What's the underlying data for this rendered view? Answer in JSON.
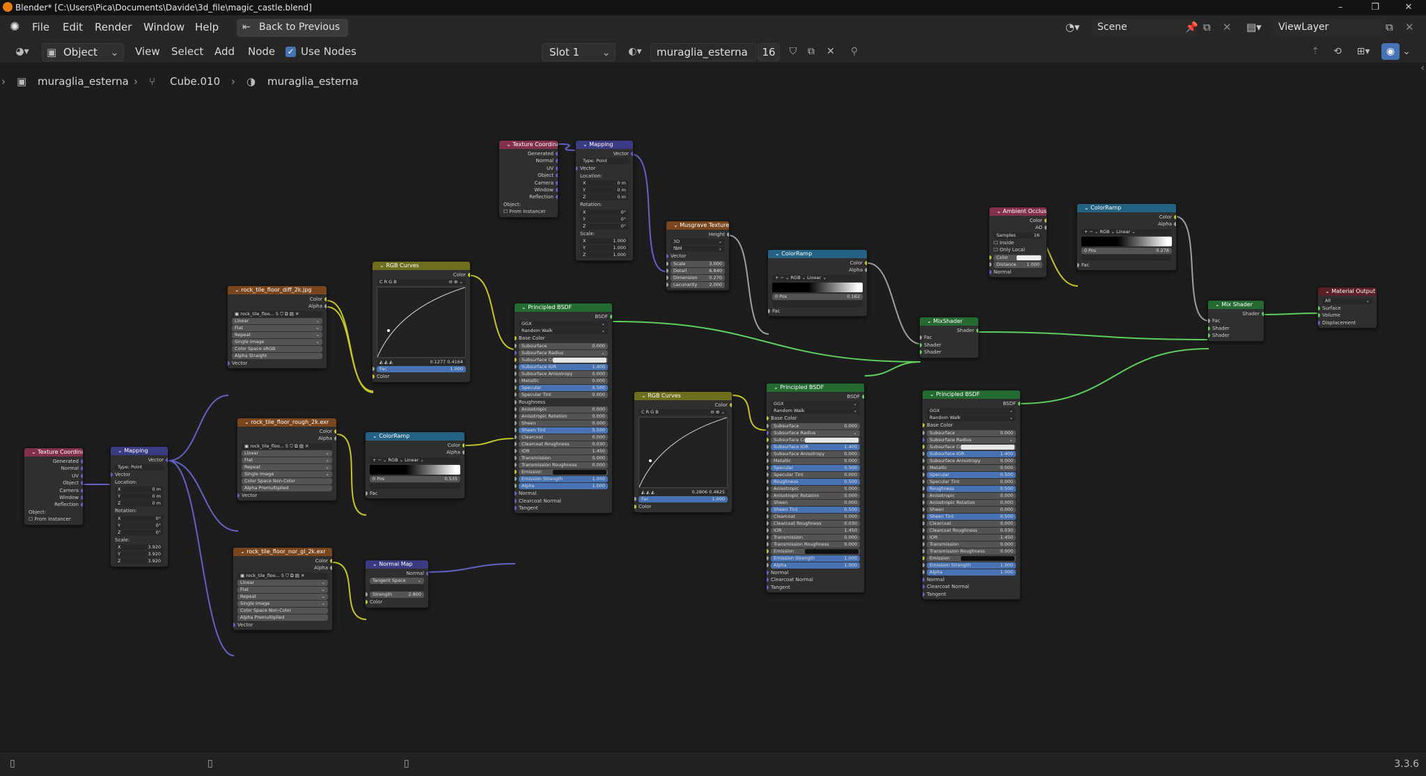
{
  "window": {
    "title": "Blender* [C:\\Users\\Pica\\Documents\\Davide\\3d_file\\magic_castle.blend]",
    "minimize": "–",
    "restore": "❐",
    "close": "✕"
  },
  "menu": {
    "items": [
      "File",
      "Edit",
      "Render",
      "Window",
      "Help"
    ],
    "back_button": "Back to Previous",
    "scene_label": "Scene",
    "viewlayer_label": "ViewLayer"
  },
  "editor_header": {
    "mode": "Object",
    "menus": [
      "View",
      "Select",
      "Add",
      "Node"
    ],
    "use_nodes_label": "Use Nodes",
    "use_nodes_checked": true,
    "slot": "Slot 1",
    "material_name": "muraglia_esterna",
    "user_count": "16"
  },
  "breadcrumb": [
    "muraglia_esterna",
    "Cube.010",
    "muraglia_esterna"
  ],
  "nodes": {
    "texcoord1": {
      "title": "Texture Coordinate",
      "outputs": [
        "Generated",
        "Normal",
        "UV",
        "Object",
        "Camera",
        "Window",
        "Reflection"
      ],
      "object_label": "Object:",
      "from_instancer": "From Instancer"
    },
    "mapping1": {
      "title": "Mapping",
      "out": "Vector",
      "type_label": "Type:",
      "type_value": "Point",
      "in": "Vector",
      "location": "Location:",
      "rotation": "Rotation:",
      "scale": "Scale:",
      "loc": [
        [
          "X",
          "0 m"
        ],
        [
          "Y",
          "0 m"
        ],
        [
          "Z",
          "0 m"
        ]
      ],
      "rot": [
        [
          "X",
          "0°"
        ],
        [
          "Y",
          "0°"
        ],
        [
          "Z",
          "0°"
        ]
      ],
      "scl": [
        [
          "X",
          "3.920"
        ],
        [
          "Y",
          "3.920"
        ],
        [
          "Z",
          "3.920"
        ]
      ]
    },
    "img_diff": {
      "title": "rock_tile_floor_diff_2k.jpg",
      "outputs": [
        "Color",
        "Alpha"
      ],
      "file": "rock_tile_floo...",
      "users": "5",
      "opts": [
        "Linear",
        "Flat",
        "Repeat",
        "Single Image"
      ],
      "cs_label": "Color Space",
      "cs_value": "sRGB",
      "alpha_label": "Alpha",
      "alpha_value": "Straight",
      "in": "Vector"
    },
    "img_rough": {
      "title": "rock_tile_floor_rough_2k.exr",
      "outputs": [
        "Color",
        "Alpha"
      ],
      "file": "rock_tile_floo...",
      "users": "5",
      "opts": [
        "Linear",
        "Flat",
        "Repeat",
        "Single Image"
      ],
      "cs_label": "Color Space",
      "cs_value": "Non-Color",
      "alpha_label": "Alpha",
      "alpha_value": "Premultiplied",
      "in": "Vector"
    },
    "img_nor": {
      "title": "rock_tile_floor_nor_gl_2k.exr",
      "outputs": [
        "Color",
        "Alpha"
      ],
      "file": "rock_tile_floo...",
      "users": "5",
      "opts": [
        "Linear",
        "Flat",
        "Repeat",
        "Single Image"
      ],
      "cs_label": "Color Space",
      "cs_value": "Non-Color",
      "alpha_label": "Alpha",
      "alpha_value": "Premultiplied",
      "in": "Vector"
    },
    "curves1": {
      "title": "RGB Curves",
      "out": "Color",
      "chans": [
        "C",
        "R",
        "G",
        "B"
      ],
      "px": "0.1277",
      "py": "0.4164",
      "fac_label": "Fac",
      "fac": "1.000",
      "in": "Color"
    },
    "ramp1": {
      "title": "ColorRamp",
      "outputs": [
        "Color",
        "Alpha"
      ],
      "mode": "RGB",
      "interp": "Linear",
      "idx": "0",
      "pos_label": "Pos",
      "pos": "0.535",
      "in": "Fac"
    },
    "normalmap": {
      "title": "Normal Map",
      "out": "Normal",
      "space": "Tangent Space",
      "strength_label": "Strength",
      "strength": "2.800",
      "in": "Color"
    },
    "texcoord2": {
      "title": "Texture Coordinate",
      "outputs": [
        "Generated",
        "Normal",
        "UV",
        "Object",
        "Camera",
        "Window",
        "Reflection"
      ],
      "object_label": "Object:",
      "from_instancer": "From Instancer"
    },
    "mapping2": {
      "title": "Mapping",
      "out": "Vector",
      "type_label": "Type:",
      "type_value": "Point",
      "in": "Vector",
      "location": "Location:",
      "rotation": "Rotation:",
      "scale": "Scale:",
      "loc": [
        [
          "X",
          "0 m"
        ],
        [
          "Y",
          "0 m"
        ],
        [
          "Z",
          "0 m"
        ]
      ],
      "rot": [
        [
          "X",
          "0°"
        ],
        [
          "Y",
          "0°"
        ],
        [
          "Z",
          "0°"
        ]
      ],
      "scl": [
        [
          "X",
          "1.000"
        ],
        [
          "Y",
          "1.000"
        ],
        [
          "Z",
          "1.000"
        ]
      ]
    },
    "musgrave": {
      "title": "Musgrave Texture",
      "out": "Height",
      "dim": "3D",
      "kind": "fBM",
      "in": "Vector",
      "fields": [
        [
          "Scale",
          "3.000"
        ],
        [
          "Detail",
          "6.840"
        ],
        [
          "Dimension",
          "0.270"
        ],
        [
          "Lacunarity",
          "2.000"
        ]
      ]
    },
    "bsdf1": {
      "title": "Principled BSDF",
      "out": "BSDF",
      "dist": "GGX",
      "sss": "Random Walk",
      "rows": [
        [
          "Base Color",
          ""
        ],
        [
          "Subsurface",
          "0.000"
        ],
        [
          "Subsurface Radius",
          ""
        ],
        [
          "Subsurface Colo",
          ""
        ],
        [
          "Subsurface IOR",
          "1.400"
        ],
        [
          "Subsurface Anisotropy",
          "0.000"
        ],
        [
          "Metallic",
          "0.000"
        ],
        [
          "Specular",
          "0.500"
        ],
        [
          "Specular Tint",
          "0.000"
        ],
        [
          "Roughness",
          ""
        ],
        [
          "Anisotropic",
          "0.000"
        ],
        [
          "Anisotropic Rotation",
          "0.000"
        ],
        [
          "Sheen",
          "0.000"
        ],
        [
          "Sheen Tint",
          "0.500"
        ],
        [
          "Clearcoat",
          "0.000"
        ],
        [
          "Clearcoat Roughness",
          "0.030"
        ],
        [
          "IOR",
          "1.450"
        ],
        [
          "Transmission",
          "0.000"
        ],
        [
          "Transmission Roughness",
          "0.000"
        ],
        [
          "Emission",
          ""
        ],
        [
          "Emission Strength",
          "1.000"
        ],
        [
          "Alpha",
          "1.000"
        ],
        [
          "Normal",
          ""
        ],
        [
          "Clearcoat Normal",
          ""
        ],
        [
          "Tangent",
          ""
        ]
      ]
    },
    "curves2": {
      "title": "RGB Curves",
      "out": "Color",
      "chans": [
        "C",
        "R",
        "G",
        "B"
      ],
      "px": "0.2806",
      "py": "0.4825",
      "fac_label": "Fac",
      "fac": "1.000",
      "in": "Color"
    },
    "ramp2": {
      "title": "ColorRamp",
      "outputs": [
        "Color",
        "Alpha"
      ],
      "mode": "RGB",
      "interp": "Linear",
      "idx": "0",
      "pos_label": "Pos",
      "pos": "0.162",
      "in": "Fac"
    },
    "bsdf2": {
      "title": "Principled BSDF",
      "out": "BSDF",
      "dist": "GGX",
      "sss": "Random Walk",
      "rows": [
        [
          "Base Color",
          ""
        ],
        [
          "Subsurface",
          "0.000"
        ],
        [
          "Subsurface Radius",
          ""
        ],
        [
          "Subsurface Colo",
          ""
        ],
        [
          "Subsurface IOR",
          "1.400"
        ],
        [
          "Subsurface Anisotropy",
          "0.000"
        ],
        [
          "Metallic",
          "0.000"
        ],
        [
          "Specular",
          "0.500"
        ],
        [
          "Specular Tint",
          "0.000"
        ],
        [
          "Roughness",
          "0.500"
        ],
        [
          "Anisotropic",
          "0.000"
        ],
        [
          "Anisotropic Rotation",
          "0.000"
        ],
        [
          "Sheen",
          "0.000"
        ],
        [
          "Sheen Tint",
          "0.500"
        ],
        [
          "Clearcoat",
          "0.000"
        ],
        [
          "Clearcoat Roughness",
          "0.030"
        ],
        [
          "IOR",
          "1.450"
        ],
        [
          "Transmission",
          "0.000"
        ],
        [
          "Transmission Roughness",
          "0.000"
        ],
        [
          "Emission",
          ""
        ],
        [
          "Emission Strength",
          "1.000"
        ],
        [
          "Alpha",
          "1.000"
        ],
        [
          "Normal",
          ""
        ],
        [
          "Clearcoat Normal",
          ""
        ],
        [
          "Tangent",
          ""
        ]
      ]
    },
    "mix1": {
      "title": "MixShader",
      "out": "Shader",
      "inputs": [
        "Fac",
        "Shader",
        "Shader"
      ]
    },
    "bsdf3": {
      "title": "Principled BSDF",
      "out": "BSDF",
      "dist": "GGX",
      "sss": "Random Walk",
      "rows": [
        [
          "Base Color",
          ""
        ],
        [
          "Subsurface",
          "0.000"
        ],
        [
          "Subsurface Radius",
          ""
        ],
        [
          "Subsurface Colo",
          ""
        ],
        [
          "Subsurface IOR",
          "1.400"
        ],
        [
          "Subsurface Anisotropy",
          "0.000"
        ],
        [
          "Metallic",
          "0.000"
        ],
        [
          "Specular",
          "0.500"
        ],
        [
          "Specular Tint",
          "0.000"
        ],
        [
          "Roughness",
          "0.500"
        ],
        [
          "Anisotropic",
          "0.000"
        ],
        [
          "Anisotropic Rotation",
          "0.000"
        ],
        [
          "Sheen",
          "0.000"
        ],
        [
          "Sheen Tint",
          "0.500"
        ],
        [
          "Clearcoat",
          "0.000"
        ],
        [
          "Clearcoat Roughness",
          "0.030"
        ],
        [
          "IOR",
          "1.450"
        ],
        [
          "Transmission",
          "0.000"
        ],
        [
          "Transmission Roughness",
          "0.000"
        ],
        [
          "Emission",
          ""
        ],
        [
          "Emission Strength",
          "1.000"
        ],
        [
          "Alpha",
          "1.000"
        ],
        [
          "Normal",
          ""
        ],
        [
          "Clearcoat Normal",
          ""
        ],
        [
          "Tangent",
          ""
        ]
      ]
    },
    "ao": {
      "title": "Ambient Occlusion",
      "outputs": [
        "Color",
        "AO"
      ],
      "samples_label": "Samples",
      "samples": "16",
      "inside": "Inside",
      "only_local": "Only Local",
      "color": "Color",
      "distance_label": "Distance",
      "distance": "1.000",
      "normal": "Normal"
    },
    "ramp3": {
      "title": "ColorRamp",
      "outputs": [
        "Color",
        "Alpha"
      ],
      "mode": "RGB",
      "interp": "Linear",
      "idx": "0",
      "pos_label": "Pos",
      "pos": "0.278",
      "in": "Fac"
    },
    "mix2": {
      "title": "Mix Shader",
      "out": "Shader",
      "inputs": [
        "Fac",
        "Shader",
        "Shader"
      ]
    },
    "output": {
      "title": "Material Output",
      "target": "All",
      "inputs": [
        "Surface",
        "Volume",
        "Displacement"
      ]
    }
  },
  "status": {
    "version": "3.3.6"
  },
  "colors": {
    "wire_green": "#5fcf5f",
    "wire_yellow": "#c7c729",
    "wire_purple": "#6363c7",
    "wire_gray": "#a1a1a1",
    "accent_blue": "#4772b3"
  }
}
